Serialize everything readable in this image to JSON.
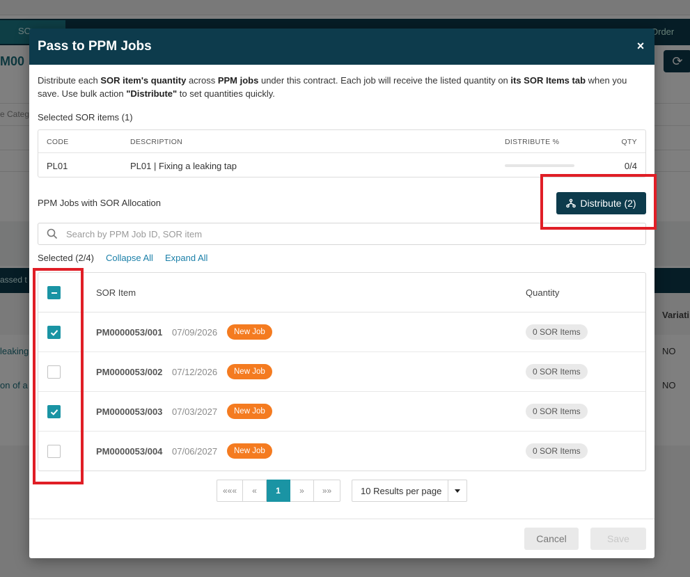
{
  "background": {
    "nav_tab": "SO",
    "nav_right": "Order",
    "page_title_fragment": "M00",
    "category_fragment": "e Categ",
    "band_fragment": "assed t",
    "column_variation": "Variati",
    "row1_link": "leaking",
    "row2_link": "on of a",
    "row1_value": "NO",
    "row2_value": "NO"
  },
  "modal": {
    "title": "Pass to PPM Jobs",
    "close_label": "×",
    "intro": {
      "p1": "Distribute each ",
      "b1": "SOR item's quantity",
      "p2": " across ",
      "b2": "PPM jobs",
      "p3": " under this contract. Each job will receive the listed quantity on ",
      "b3": "its SOR Items tab",
      "p4": " when you save. Use bulk action ",
      "b4": "\"Distribute\"",
      "p5": " to set quantities quickly."
    },
    "selected_sor_label": "Selected SOR items (1)",
    "sor_table": {
      "headers": {
        "code": "CODE",
        "description": "DESCRIPTION",
        "distribute": "DISTRIBUTE %",
        "qty": "QTY"
      },
      "rows": [
        {
          "code": "PL01",
          "description": "PL01 | Fixing a leaking tap",
          "distribute_progress": 0,
          "qty": "0/4"
        }
      ]
    },
    "ppm_section_label": "PPM Jobs with SOR Allocation",
    "distribute_button": "Distribute (2)",
    "search": {
      "placeholder": "Search by PPM Job ID, SOR item",
      "value": ""
    },
    "selected_count": "Selected (2/4)",
    "collapse_all": "Collapse All",
    "expand_all": "Expand All",
    "jobs_table": {
      "headers": {
        "sor_item": "SOR Item",
        "quantity": "Quantity"
      },
      "header_checkbox_state": "indeterminate",
      "rows": [
        {
          "id": "PM0000053/001",
          "date": "07/09/2026",
          "badge": "New Job",
          "qty": "0 SOR Items",
          "checked": true
        },
        {
          "id": "PM0000053/002",
          "date": "07/12/2026",
          "badge": "New Job",
          "qty": "0 SOR Items",
          "checked": false
        },
        {
          "id": "PM0000053/003",
          "date": "07/03/2027",
          "badge": "New Job",
          "qty": "0 SOR Items",
          "checked": true
        },
        {
          "id": "PM0000053/004",
          "date": "07/06/2027",
          "badge": "New Job",
          "qty": "0 SOR Items",
          "checked": false
        }
      ]
    },
    "pagination": {
      "first": "«««",
      "prev": "«",
      "current": "1",
      "next": "»",
      "last": "»»"
    },
    "per_page": "10 Results per page",
    "cancel_button": "Cancel",
    "save_button": "Save"
  },
  "icons": {
    "close": "close-icon",
    "distribute": "branch-icon",
    "search": "search-icon",
    "checkbox_checked": "check-icon",
    "checkbox_indeterminate": "minus-icon",
    "per_page_caret": "caret-down-icon"
  },
  "colors": {
    "header_bg": "#0d3b4c",
    "accent_teal": "#1a94a4",
    "badge_orange": "#f47b20",
    "link_blue": "#1a7fa8",
    "annotation_red": "#e01e26"
  }
}
